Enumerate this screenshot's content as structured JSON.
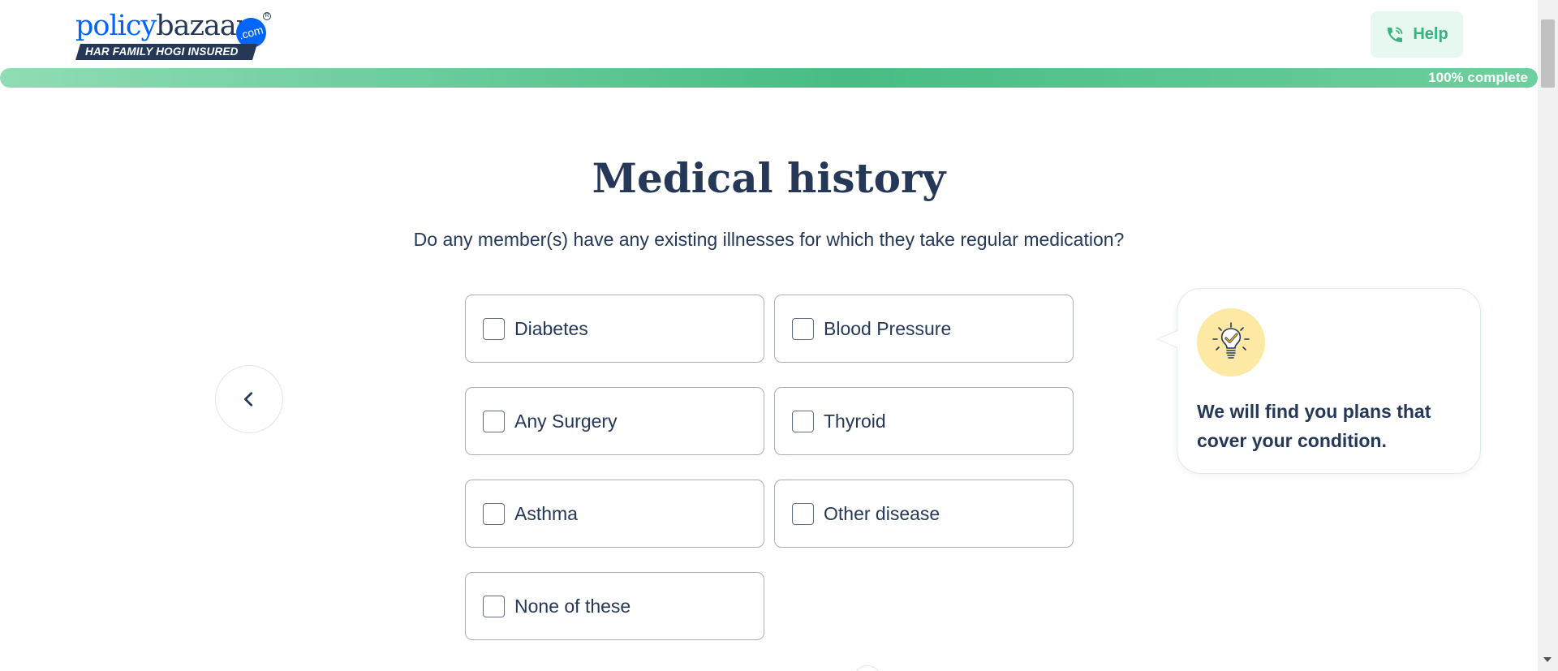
{
  "header": {
    "logo": {
      "word_part1": "policy",
      "word_part2": "bazaar",
      "com": ".com",
      "registered": "R",
      "tagline": "HAR FAMILY HOGI INSURED"
    },
    "help_label": "Help",
    "help_icon": "phone-call-icon"
  },
  "progress": {
    "percent": 100,
    "label": "100% complete"
  },
  "main": {
    "title": "Medical history",
    "question": "Do any member(s) have any existing illnesses for which they take regular medication?",
    "back_icon": "chevron-left-icon",
    "options": [
      {
        "label": "Diabetes",
        "checked": false
      },
      {
        "label": "Blood Pressure",
        "checked": false
      },
      {
        "label": "Any Surgery",
        "checked": false
      },
      {
        "label": "Thyroid",
        "checked": false
      },
      {
        "label": "Asthma",
        "checked": false
      },
      {
        "label": "Other disease",
        "checked": false
      },
      {
        "label": "None of these",
        "checked": false
      }
    ]
  },
  "tip": {
    "icon": "lightbulb-check-icon",
    "text": "We will find you plans that cover your condition."
  },
  "colors": {
    "brand_blue": "#0065ff",
    "navy": "#253858",
    "green": "#36b37e",
    "help_bg": "#e6f8ef",
    "bulb_bg": "#fde9a3"
  }
}
